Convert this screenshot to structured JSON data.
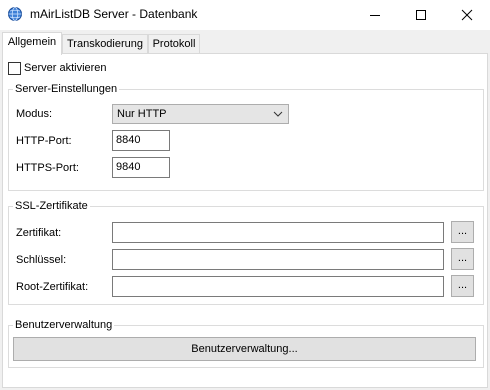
{
  "window": {
    "title": "mAirListDB Server - Datenbank",
    "icon": "globe-icon"
  },
  "tabs": [
    {
      "label": "Allgemein",
      "active": true
    },
    {
      "label": "Transkodierung",
      "active": false
    },
    {
      "label": "Protokoll",
      "active": false
    }
  ],
  "server_enabled": {
    "label": "Server aktivieren",
    "checked": false
  },
  "server_settings": {
    "title": "Server-Einstellungen",
    "mode_label": "Modus:",
    "mode_value": "Nur HTTP",
    "http_port_label": "HTTP-Port:",
    "http_port_value": "8840",
    "https_port_label": "HTTPS-Port:",
    "https_port_value": "9840"
  },
  "ssl": {
    "title": "SSL-Zertifikate",
    "certificate_label": "Zertifikat:",
    "certificate_value": "",
    "key_label": "Schlüssel:",
    "key_value": "",
    "root_label": "Root-Zertifikat:",
    "root_value": "",
    "browse_label": "..."
  },
  "user_management": {
    "title": "Benutzerverwaltung",
    "button_label": "Benutzerverwaltung..."
  }
}
